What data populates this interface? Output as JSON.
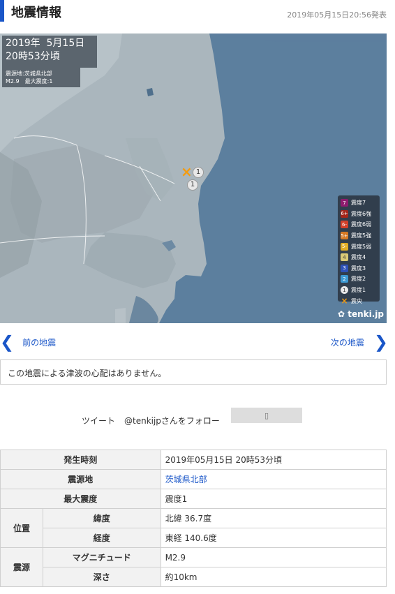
{
  "header": {
    "title": "地震情報",
    "published": "2019年05月15日20:56発表",
    "accent_color": "#1a56c8"
  },
  "map": {
    "date_label": "2019年  5月15日",
    "time_label": "20時53分頃",
    "epicenter_line": "震源地:茨城県北部",
    "magnitude_line": "M2.9　最大震度:1",
    "epicenter_marker": "×",
    "intensity_marker_1": "1",
    "intensity_marker_2": "1",
    "logo": "tenki.jp",
    "legend": [
      {
        "code": "7",
        "label": "震度7",
        "color": "#8e1b6e"
      },
      {
        "code": "6+",
        "label": "震度6強",
        "color": "#a3261a"
      },
      {
        "code": "6-",
        "label": "震度6弱",
        "color": "#d2402a"
      },
      {
        "code": "5+",
        "label": "震度5強",
        "color": "#d77924"
      },
      {
        "code": "5-",
        "label": "震度5弱",
        "color": "#e1ad25"
      },
      {
        "code": "4",
        "label": "震度4",
        "color": "#d9c977"
      },
      {
        "code": "3",
        "label": "震度3",
        "color": "#2e52b8"
      },
      {
        "code": "2",
        "label": "震度2",
        "color": "#3d9ad3"
      },
      {
        "code": "1",
        "label": "震度1",
        "color": "#e8e8e8"
      },
      {
        "code": "×",
        "label": "震央",
        "color": "#f39c12"
      }
    ]
  },
  "nav": {
    "prev_label": "前の地震",
    "next_label": "次の地震"
  },
  "notice": "この地震による津波の心配はありません。",
  "social": {
    "tweet_label": "ツイート",
    "follow_label": "@tenkijpさんをフォロー"
  },
  "table": {
    "occurrence_time_label": "発生時刻",
    "occurrence_time_value": "2019年05月15日 20時53分頃",
    "epicenter_label": "震源地",
    "epicenter_value": "茨城県北部",
    "max_intensity_label": "最大震度",
    "max_intensity_value": "震度1",
    "position_label": "位置",
    "latitude_label": "緯度",
    "latitude_value": "北緯 36.7度",
    "longitude_label": "経度",
    "longitude_value": "東経 140.6度",
    "source_label": "震源",
    "magnitude_label": "マグニチュード",
    "magnitude_value": "M2.9",
    "depth_label": "深さ",
    "depth_value": "約10km"
  }
}
